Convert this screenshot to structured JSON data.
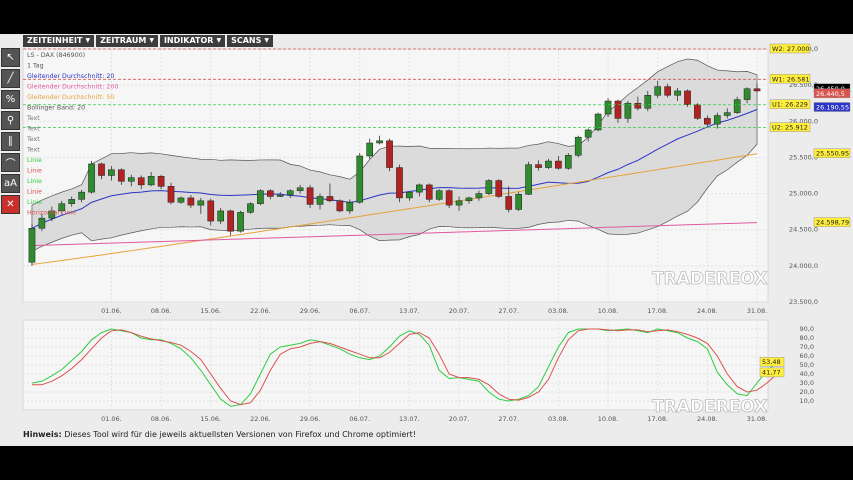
{
  "toolbar": {
    "items": [
      {
        "label": "ZEITEINHEIT"
      },
      {
        "label": "ZEITRAUM"
      },
      {
        "label": "INDIKATOR"
      },
      {
        "label": "SCANS"
      }
    ]
  },
  "tools": [
    {
      "icon": "cursor-icon",
      "glyph": "↖"
    },
    {
      "icon": "line-icon",
      "glyph": "╱"
    },
    {
      "icon": "percent-icon",
      "glyph": "%"
    },
    {
      "icon": "zoom-icon",
      "glyph": "⚲"
    },
    {
      "icon": "parallel-lines-icon",
      "glyph": "∥"
    },
    {
      "icon": "curve-icon",
      "glyph": "⌒"
    },
    {
      "icon": "text-icon",
      "glyph": "aA"
    },
    {
      "icon": "delete-icon",
      "glyph": "✕"
    }
  ],
  "legend": [
    {
      "text": "LS - DAX (846900)",
      "color": "#555555"
    },
    {
      "text": "1 Tag",
      "color": "#555555"
    },
    {
      "text": "Gleitender Durchschnitt: 20",
      "color": "#2b35c6"
    },
    {
      "text": "Gleitender Durchschnitt: 200",
      "color": "#e05aa0"
    },
    {
      "text": "Gleitender Durchschnitt: 50",
      "color": "#e8a23c"
    },
    {
      "text": "Bollinger Band: 20",
      "color": "#555555"
    },
    {
      "text": "Text",
      "color": "#777777"
    },
    {
      "text": "Text",
      "color": "#777777"
    },
    {
      "text": "Text",
      "color": "#777777"
    },
    {
      "text": "Text",
      "color": "#777777"
    },
    {
      "text": "Linie",
      "color": "#2ecc40"
    },
    {
      "text": "Linie",
      "color": "#d9534f"
    },
    {
      "text": "Linie",
      "color": "#2ecc40"
    },
    {
      "text": "Linie",
      "color": "#d9534f"
    },
    {
      "text": "Linie",
      "color": "#2ecc40"
    },
    {
      "text": "Horizontal Linie",
      "color": "#d9534f"
    }
  ],
  "hint": {
    "label": "Hinweis:",
    "text": " Dieses Tool wird für die jeweils aktuellsten Versionen von Firefox und Chrome optimiert!"
  },
  "watermark": "TRADEREOX",
  "chart_data": [
    {
      "type": "candlestick",
      "title": "LS - DAX (846900)",
      "ylim": [
        23500,
        27000
      ],
      "y_ticks": [
        "27.000,0",
        "26.500,0",
        "26.000,0",
        "25.500,0",
        "25.000,0",
        "24.500,0",
        "24.000,0",
        "23.500,0"
      ],
      "x_ticks": [
        "01.06.",
        "08.06.",
        "15.06.",
        "22.06.",
        "29.06.",
        "06.07.",
        "13.07.",
        "20.07.",
        "27.07.",
        "03.08.",
        "10.08.",
        "17.08.",
        "24.08.",
        "31.08."
      ],
      "x_tick_index": [
        8,
        13,
        18,
        23,
        28,
        33,
        38,
        43,
        48,
        53,
        58,
        63,
        68,
        73
      ],
      "ohlc": [
        [
          24050,
          24580,
          24000,
          24520
        ],
        [
          24520,
          24720,
          24480,
          24660
        ],
        [
          24660,
          24820,
          24620,
          24760
        ],
        [
          24760,
          24900,
          24720,
          24860
        ],
        [
          24860,
          24960,
          24820,
          24920
        ],
        [
          24920,
          25050,
          24880,
          25020
        ],
        [
          25020,
          25450,
          25000,
          25410
        ],
        [
          25410,
          25430,
          25200,
          25250
        ],
        [
          25250,
          25380,
          25180,
          25330
        ],
        [
          25330,
          25350,
          25120,
          25170
        ],
        [
          25170,
          25260,
          25100,
          25220
        ],
        [
          25220,
          25250,
          25060,
          25120
        ],
        [
          25120,
          25300,
          25100,
          25240
        ],
        [
          25240,
          25260,
          25060,
          25100
        ],
        [
          25100,
          25150,
          24850,
          24880
        ],
        [
          24880,
          24960,
          24860,
          24940
        ],
        [
          24940,
          24980,
          24800,
          24840
        ],
        [
          24840,
          24940,
          24720,
          24900
        ],
        [
          24900,
          24930,
          24560,
          24620
        ],
        [
          24620,
          24800,
          24580,
          24760
        ],
        [
          24760,
          24780,
          24420,
          24480
        ],
        [
          24480,
          24760,
          24460,
          24740
        ],
        [
          24740,
          24880,
          24720,
          24860
        ],
        [
          24860,
          25060,
          24840,
          25040
        ],
        [
          25040,
          25060,
          24920,
          24960
        ],
        [
          24960,
          25020,
          24950,
          24980
        ],
        [
          24980,
          25060,
          24940,
          25040
        ],
        [
          25040,
          25120,
          25000,
          25080
        ],
        [
          25080,
          25120,
          24800,
          24850
        ],
        [
          24850,
          25000,
          24780,
          24960
        ],
        [
          24960,
          25140,
          24880,
          24900
        ],
        [
          24900,
          24920,
          24740,
          24760
        ],
        [
          24760,
          24920,
          24720,
          24880
        ],
        [
          24880,
          25560,
          24860,
          25520
        ],
        [
          25520,
          25760,
          25480,
          25700
        ],
        [
          25700,
          25800,
          25680,
          25730
        ],
        [
          25730,
          25760,
          25310,
          25360
        ],
        [
          25360,
          25400,
          24880,
          24940
        ],
        [
          24940,
          25020,
          24900,
          25020
        ],
        [
          25020,
          25140,
          24960,
          25120
        ],
        [
          25120,
          25140,
          24880,
          24920
        ],
        [
          24920,
          25060,
          24900,
          25040
        ],
        [
          25040,
          25060,
          24800,
          24840
        ],
        [
          24840,
          24960,
          24760,
          24900
        ],
        [
          24900,
          24960,
          24860,
          24940
        ],
        [
          24940,
          25040,
          24900,
          25000
        ],
        [
          25000,
          25200,
          24980,
          25180
        ],
        [
          25180,
          25200,
          24940,
          24960
        ],
        [
          24960,
          25100,
          24740,
          24780
        ],
        [
          24780,
          25020,
          24760,
          24990
        ],
        [
          24990,
          25440,
          24980,
          25400
        ],
        [
          25400,
          25460,
          25320,
          25360
        ],
        [
          25360,
          25480,
          25340,
          25450
        ],
        [
          25450,
          25520,
          25330,
          25350
        ],
        [
          25350,
          25560,
          25330,
          25530
        ],
        [
          25530,
          25800,
          25500,
          25780
        ],
        [
          25780,
          25900,
          25720,
          25880
        ],
        [
          25880,
          26120,
          25860,
          26100
        ],
        [
          26100,
          26320,
          26060,
          26280
        ],
        [
          26280,
          26300,
          25980,
          26040
        ],
        [
          26040,
          26280,
          25980,
          26250
        ],
        [
          26250,
          26340,
          26150,
          26180
        ],
        [
          26180,
          26420,
          26140,
          26360
        ],
        [
          26360,
          26560,
          26320,
          26480
        ],
        [
          26480,
          26520,
          26330,
          26360
        ],
        [
          26360,
          26460,
          26280,
          26420
        ],
        [
          26420,
          26440,
          26200,
          26230
        ],
        [
          26230,
          26250,
          26020,
          26040
        ],
        [
          26040,
          26080,
          25930,
          25960
        ],
        [
          25960,
          26120,
          25900,
          26080
        ],
        [
          26080,
          26180,
          26040,
          26120
        ],
        [
          26120,
          26340,
          26100,
          26300
        ],
        [
          26300,
          26470,
          26250,
          26450
        ],
        [
          26450,
          26520,
          26400,
          26420
        ]
      ],
      "ma20_end": 26190.55,
      "ma50_end": 25550.95,
      "ma200_end": 24598.79,
      "hlines": [
        {
          "label": "W2: 27.000",
          "value": 27000,
          "color": "#d9534f"
        },
        {
          "label": "W1: 26.581",
          "value": 26581,
          "color": "#d9534f"
        },
        {
          "label": "U1: 26.229",
          "value": 26229,
          "color": "#2ecc40"
        },
        {
          "label": "U2: 25.912",
          "value": 25912,
          "color": "#2ecc40"
        }
      ],
      "price_badges": [
        {
          "label": "26.450,0",
          "value": 26450,
          "color": "#000000"
        },
        {
          "label": "26.440,5",
          "value": 26380,
          "color": "#d9534f"
        },
        {
          "label": "26.190,55",
          "value": 26190.55,
          "color": "#2b35c6"
        },
        {
          "label": "25.550,95",
          "value": 25550.95,
          "color": "#e8a23c"
        },
        {
          "label": "24.598,79",
          "value": 24598.79,
          "color": "#e05aa0"
        }
      ]
    },
    {
      "type": "line",
      "ylim": [
        0,
        100
      ],
      "y_ticks": [
        "90,0",
        "80,0",
        "70,0",
        "60,0",
        "50,0",
        "40,0",
        "30,0",
        "20,0",
        "10,0"
      ],
      "series": [
        {
          "color": "#2ecc40",
          "values": [
            30,
            32,
            38,
            45,
            55,
            65,
            78,
            86,
            90,
            88,
            86,
            80,
            78,
            78,
            74,
            68,
            58,
            44,
            28,
            12,
            4,
            6,
            18,
            40,
            62,
            70,
            72,
            74,
            78,
            76,
            72,
            68,
            62,
            58,
            56,
            60,
            70,
            82,
            88,
            84,
            72,
            44,
            35,
            36,
            34,
            32,
            20,
            12,
            10,
            12,
            16,
            26,
            48,
            70,
            86,
            90,
            90,
            90,
            88,
            89,
            90,
            88,
            86,
            90,
            88,
            86,
            80,
            76,
            68,
            42,
            28,
            18,
            16,
            30,
            44,
            52
          ]
        },
        {
          "color": "#d9534f",
          "values": [
            28,
            28,
            32,
            38,
            46,
            56,
            68,
            80,
            88,
            89,
            86,
            82,
            79,
            77,
            75,
            72,
            65,
            56,
            40,
            24,
            10,
            6,
            8,
            22,
            44,
            62,
            68,
            70,
            74,
            76,
            74,
            70,
            66,
            62,
            58,
            58,
            64,
            74,
            84,
            86,
            80,
            62,
            40,
            36,
            36,
            34,
            28,
            18,
            12,
            11,
            14,
            20,
            34,
            58,
            78,
            88,
            90,
            90,
            89,
            88,
            89,
            89,
            87,
            88,
            89,
            87,
            84,
            80,
            74,
            60,
            40,
            26,
            20,
            22,
            30,
            40
          ]
        }
      ],
      "badges": [
        {
          "label": "53,48",
          "value": 53.48
        },
        {
          "label": "41,77",
          "value": 41.77
        }
      ]
    }
  ]
}
